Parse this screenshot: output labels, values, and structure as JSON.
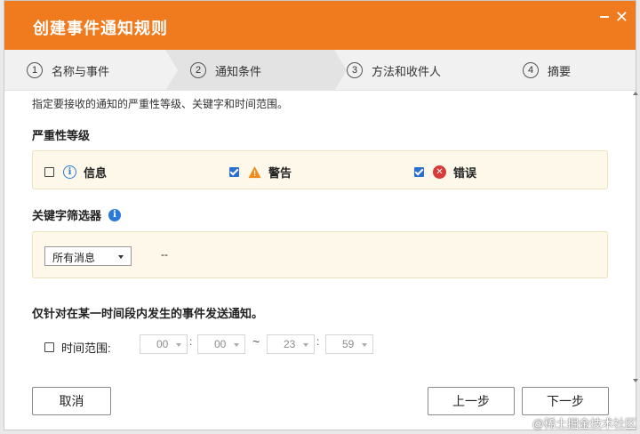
{
  "dialog": {
    "title": "创建事件通知规则",
    "minimize_glyph": "−",
    "close_glyph": "✕"
  },
  "steps": [
    {
      "num": "1",
      "label": "名称与事件",
      "active": false
    },
    {
      "num": "2",
      "label": "通知条件",
      "active": true
    },
    {
      "num": "3",
      "label": "方法和收件人",
      "active": false
    },
    {
      "num": "4",
      "label": "摘要",
      "active": false
    }
  ],
  "intro": "指定要接收的通知的严重性等级、关键字和时间范围。",
  "severity": {
    "heading": "严重性等级",
    "items": [
      {
        "label": "信息",
        "checked": false,
        "icon": "info-icon",
        "glyph": "i"
      },
      {
        "label": "警告",
        "checked": true,
        "icon": "warning-icon",
        "glyph": "!"
      },
      {
        "label": "错误",
        "checked": true,
        "icon": "error-icon",
        "glyph": "✕"
      }
    ]
  },
  "keyword": {
    "heading": "关键字筛选器",
    "help_glyph": "i",
    "select_value": "所有消息",
    "value_text": "--"
  },
  "time": {
    "heading": "仅针对在某一时间段内发生的事件发送通知。",
    "range_label": "时间范围:",
    "range_checked": false,
    "start_hour": "00",
    "start_min": "00",
    "end_hour": "23",
    "end_min": "59",
    "colon": ":",
    "tilde": "~"
  },
  "buttons": {
    "cancel": "取消",
    "prev": "上一步",
    "next": "下一步"
  },
  "watermark": "@稀土掘金技术社区",
  "colors": {
    "accent": "#f07a1e",
    "checkbox": "#2b6fd1",
    "info": "#2b7ad8",
    "warning": "#f08a1c",
    "error": "#d83a3a",
    "panel_bg": "#fdf8ea"
  }
}
